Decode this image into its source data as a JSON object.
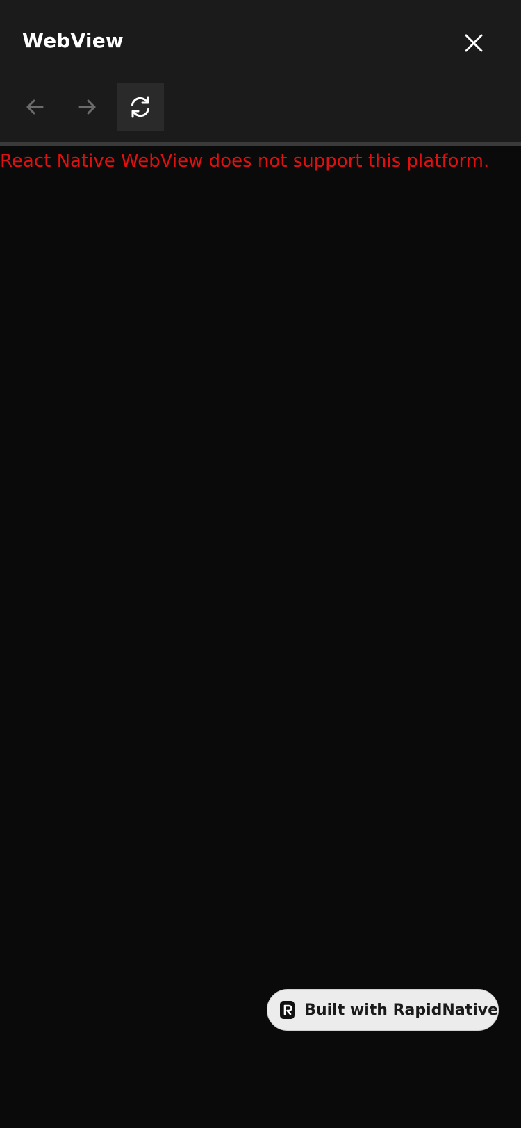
{
  "header": {
    "title": "WebView"
  },
  "toolbar": {
    "back_icon": "arrow-left-icon",
    "forward_icon": "arrow-right-icon",
    "reload_icon": "refresh-icon",
    "close_icon": "close-icon"
  },
  "content": {
    "error_message": "React Native WebView does not support this platform.",
    "error_color": "#e01010"
  },
  "badge": {
    "label": "Built with RapidNative",
    "logo_icon": "rapidnative-logo-icon"
  },
  "colors": {
    "header_bg": "#1b1b1b",
    "body_bg": "#0a0a0a",
    "badge_bg": "#ececec"
  }
}
